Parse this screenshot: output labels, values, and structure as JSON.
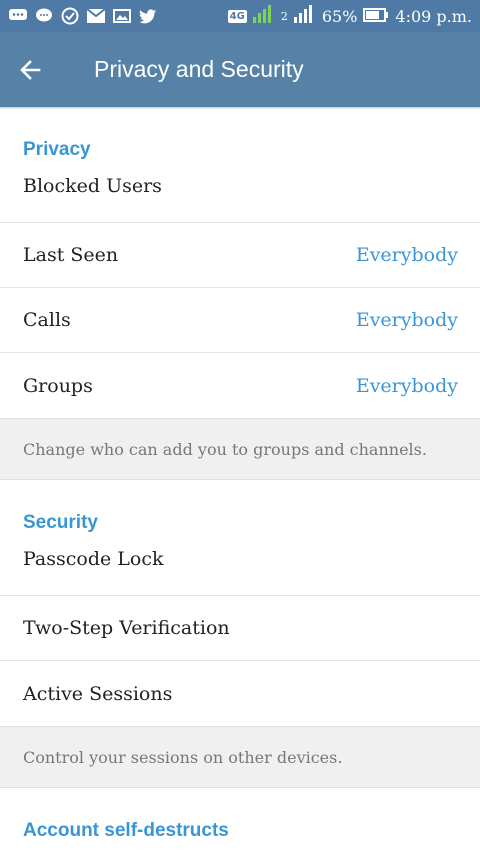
{
  "status_bar": {
    "network": "4G",
    "sim2": "2",
    "battery": "65%",
    "time": "4:09 p.m.",
    "icons": [
      "chat-icon",
      "message-icon",
      "check-circle-icon",
      "mail-icon",
      "gallery-icon",
      "twitter-icon"
    ]
  },
  "app_bar": {
    "title": "Privacy and Security",
    "back_icon": "back-arrow-icon"
  },
  "privacy": {
    "header": "Privacy",
    "items": [
      {
        "label": "Blocked Users",
        "value": ""
      },
      {
        "label": "Last Seen",
        "value": "Everybody"
      },
      {
        "label": "Calls",
        "value": "Everybody"
      },
      {
        "label": "Groups",
        "value": "Everybody"
      }
    ],
    "info": "Change who can add you to groups and channels."
  },
  "security": {
    "header": "Security",
    "items": [
      {
        "label": "Passcode Lock"
      },
      {
        "label": "Two-Step Verification"
      },
      {
        "label": "Active Sessions"
      }
    ],
    "info": "Control your sessions on other devices."
  },
  "account": {
    "header": "Account self-destructs"
  },
  "colors": {
    "appbar": "#5682a8",
    "statusbar": "#4f7aa5",
    "accent": "#3a95d5"
  }
}
